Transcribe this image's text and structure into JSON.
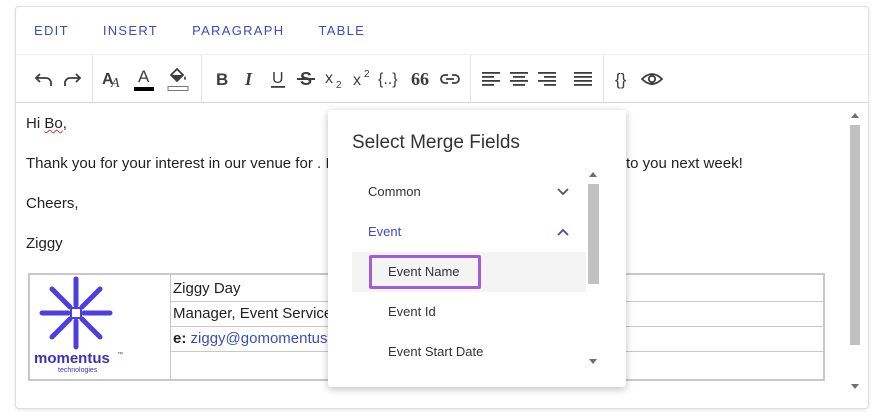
{
  "menubar": {
    "items": [
      "EDIT",
      "INSERT",
      "PARAGRAPH",
      "TABLE"
    ]
  },
  "toolbar": {
    "icons": [
      "undo-icon",
      "redo-icon",
      "font-size-icon",
      "font-color-icon",
      "fill-color-icon",
      "bold-icon",
      "italic-icon",
      "underline-icon",
      "strikethrough-icon",
      "subscript-icon",
      "superscript-icon",
      "code-block-icon",
      "quote-icon",
      "link-icon",
      "align-left-icon",
      "align-center-icon",
      "align-right-icon",
      "align-justify-icon",
      "merge-fields-icon",
      "preview-icon"
    ],
    "font_color_swatch": "#000000",
    "fill_color_swatch": "#ffffff",
    "font_size_glyph": "A",
    "font_color_glyph": "A",
    "bold_glyph": "B",
    "italic_glyph": "I",
    "underline_glyph": "U",
    "strike_glyph": "S",
    "subscript_glyph": "x",
    "subscript_index": "2",
    "superscript_glyph": "x",
    "superscript_index": "2",
    "code_glyph": "{..}",
    "quote_glyph": "66",
    "merge_glyph": "{}"
  },
  "content": {
    "greeting_prefix": "Hi ",
    "greeting_name": "Bo",
    "greeting_suffix": ",",
    "body_left": "Thank you for your interest in our venue for . I",
    "body_right": "to you next week!",
    "closing": "Cheers,",
    "signer": "Ziggy"
  },
  "signature": {
    "name": "Ziggy Day",
    "title": "Manager, Event Services",
    "email_label": "e:",
    "email": "ziggy@gomomentus.",
    "logo_text": "momentus",
    "logo_tm": "™",
    "logo_sub": "technologies"
  },
  "colors": {
    "accent": "#3b4cc0",
    "highlight": "#a25ddc",
    "logo": "#4b3fe0"
  },
  "merge_popup": {
    "title": "Select Merge Fields",
    "items": [
      {
        "label": "Common",
        "state": "collapsed"
      },
      {
        "label": "Event",
        "state": "expanded"
      },
      {
        "label": "Event Name"
      },
      {
        "label": "Event Id"
      },
      {
        "label": "Event Start Date"
      }
    ]
  }
}
